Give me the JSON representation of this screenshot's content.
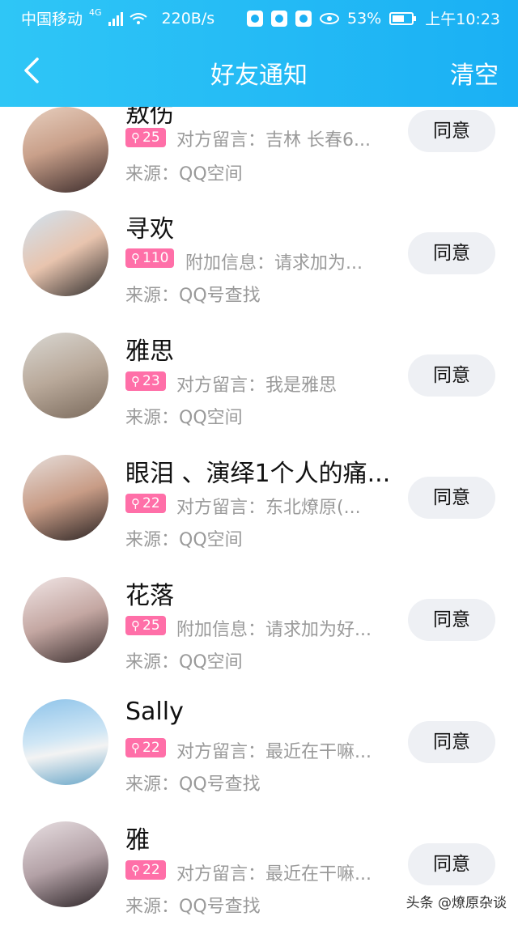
{
  "status_bar": {
    "carrier": "中国移动",
    "network": "4G",
    "speed": "220B/s",
    "battery": "53%",
    "time": "上午10:23"
  },
  "header": {
    "back_icon": "chevron-left-icon",
    "title": "好友通知",
    "clear_label": "清空"
  },
  "requests": [
    {
      "name": "敖伤",
      "age": "25",
      "message": "对方留言：吉林 长春6...",
      "source": "来源：QQ空间",
      "button": "同意",
      "avatar_colors": [
        "#e7cfbf",
        "#3b2b2b"
      ]
    },
    {
      "name": "寻欢",
      "age": "110",
      "message": "附加信息：请求加为...",
      "source": "来源：QQ号查找",
      "button": "同意",
      "avatar_colors": [
        "#cfe3f2",
        "#2c2a2a"
      ]
    },
    {
      "name": "雅思",
      "age": "23",
      "message": "对方留言：我是雅思",
      "source": "来源：QQ空间",
      "button": "同意",
      "avatar_colors": [
        "#d9d7d2",
        "#7a6a5c"
      ]
    },
    {
      "name": "眼泪 、演绎1个人的痛...",
      "age": "22",
      "message": "对方留言：东北燎原(...",
      "source": "来源：QQ空间",
      "button": "同意",
      "avatar_colors": [
        "#e6dedb",
        "#2a2323"
      ]
    },
    {
      "name": "花落",
      "age": "25",
      "message": "附加信息：请求加为好...",
      "source": "来源：QQ空间",
      "button": "同意",
      "avatar_colors": [
        "#f1e6e6",
        "#3a2e2e"
      ]
    },
    {
      "name": "Sally",
      "age": "22",
      "message": "对方留言：最近在干嘛...",
      "source": "来源：QQ号查找",
      "button": "同意",
      "avatar_colors": [
        "#8fc4ea",
        "#f3f3f3"
      ]
    },
    {
      "name": "雅",
      "age": "22",
      "message": "对方留言：最近在干嘛...",
      "source": "来源：QQ号查找",
      "button": "同意",
      "avatar_colors": [
        "#e8dfe2",
        "#2b2326"
      ]
    }
  ],
  "watermark": "头条 @燎原杂谈"
}
